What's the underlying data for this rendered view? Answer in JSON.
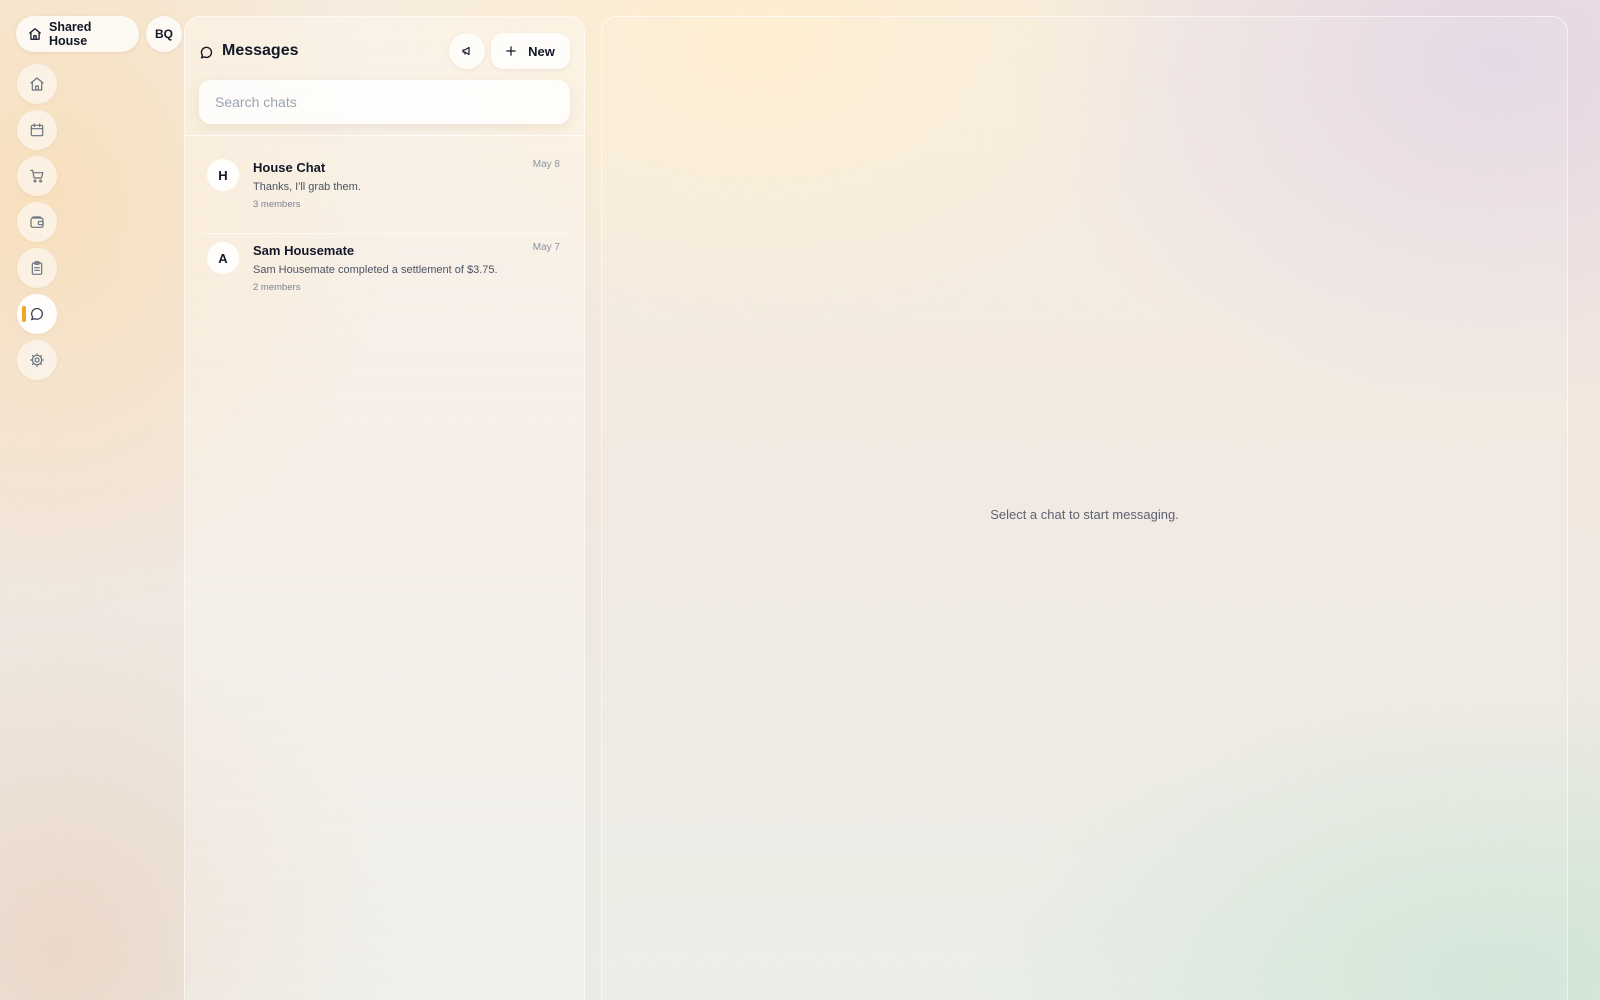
{
  "header": {
    "house_name": "Shared House",
    "user_initials": "BQ"
  },
  "nav": {
    "items": [
      {
        "icon": "home-icon",
        "active": false
      },
      {
        "icon": "calendar-icon",
        "active": false
      },
      {
        "icon": "cart-icon",
        "active": false
      },
      {
        "icon": "wallet-icon",
        "active": false
      },
      {
        "icon": "clipboard-icon",
        "active": false
      },
      {
        "icon": "chat-bubble-icon",
        "active": true
      },
      {
        "icon": "gear-icon",
        "active": false
      }
    ],
    "active_indicator_color": "#f0a526"
  },
  "chat_list": {
    "title": "Messages",
    "announce_icon": "megaphone-icon",
    "new_label": "New",
    "search_placeholder": "Search chats",
    "search_value": "",
    "chats": [
      {
        "avatar": "H",
        "name": "House Chat",
        "date": "May 8",
        "preview": "Thanks, I'll grab them.",
        "members": "3 members"
      },
      {
        "avatar": "A",
        "name": "Sam Housemate",
        "date": "May 7",
        "preview": "Sam Housemate completed a settlement of $3.75.",
        "members": "2 members"
      }
    ]
  },
  "conversation": {
    "empty_message": "Select a chat to start messaging."
  }
}
